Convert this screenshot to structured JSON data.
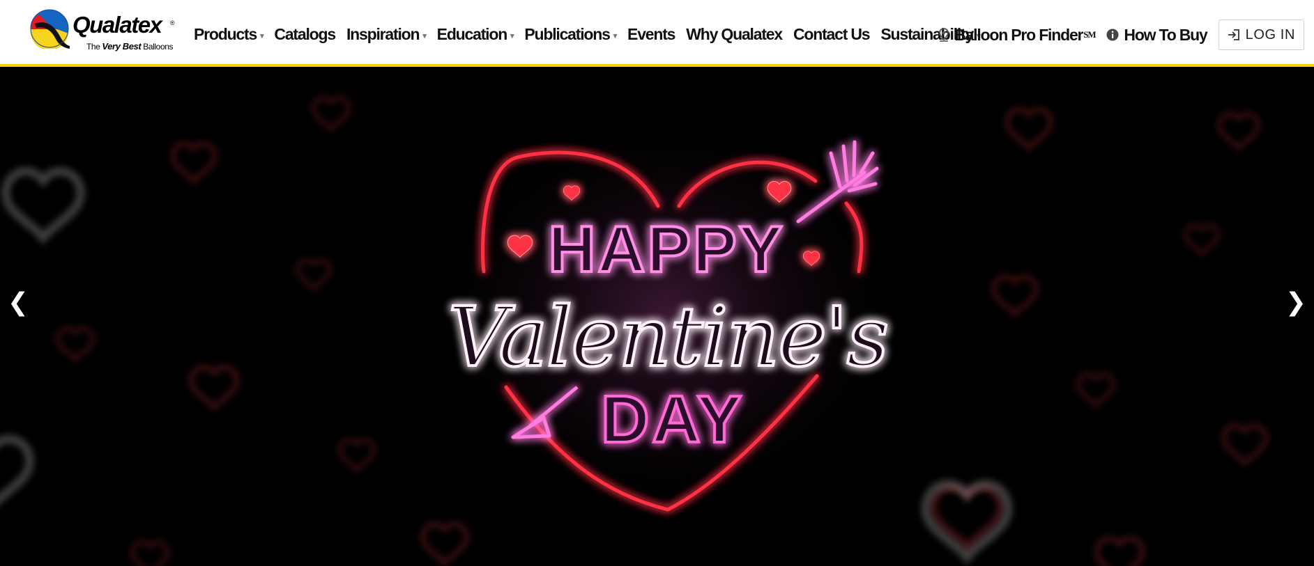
{
  "brand": {
    "name": "Qualatex",
    "registered": "®",
    "tagline_prefix": "The",
    "tagline_emphasis": "Very Best",
    "tagline_suffix": "Balloons"
  },
  "nav": {
    "items": [
      {
        "label": "Products",
        "dropdown": true
      },
      {
        "label": "Catalogs",
        "dropdown": false
      },
      {
        "label": "Inspiration",
        "dropdown": true
      },
      {
        "label": "Education",
        "dropdown": true
      },
      {
        "label": "Publications",
        "dropdown": true
      },
      {
        "label": "Events",
        "dropdown": false
      },
      {
        "label": "Why Qualatex",
        "dropdown": false
      },
      {
        "label": "Contact Us",
        "dropdown": false
      },
      {
        "label": "Sustainability",
        "dropdown": true
      }
    ],
    "caret": "▾"
  },
  "utility": {
    "finder_label": "Balloon Pro Finder",
    "finder_mark": "SM",
    "how_to_buy": "How To Buy",
    "login": "LOG IN"
  },
  "hero": {
    "headline_top": "HAPPY",
    "headline_script": "Valentine's",
    "headline_bottom": "DAY",
    "prev_arrow": "❮",
    "next_arrow": "❯"
  },
  "colors": {
    "header_border": "#f5d400",
    "neon_red": "#ff2d3c",
    "neon_pink": "#ff6ad5",
    "neon_white": "#ffe8f6",
    "background": "#000000"
  },
  "icons": {
    "finder": "map-pin-icon",
    "how_to_buy": "info-icon",
    "login": "sign-in-icon"
  }
}
